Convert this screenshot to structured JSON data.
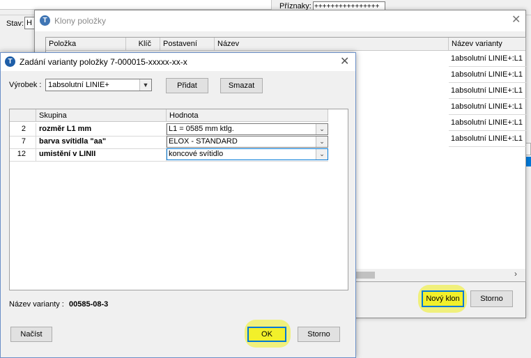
{
  "background": {
    "priznaky_label": "Příznaky:",
    "priznaky_value": "++++++++++++++++",
    "stav_label": "Stav:",
    "stav_value": "H"
  },
  "klony_window": {
    "title": "Klony položky",
    "columns": [
      "Položka",
      "Klíč",
      "Postavení",
      "Název",
      "Název varianty"
    ],
    "rows": [
      "1absolutní LINIE+:L1",
      "1absolutní LINIE+:L1",
      "1absolutní LINIE+:L1",
      "1absolutní LINIE+:L1",
      "1absolutní LINIE+:L1",
      "1absolutní LINIE+:L1"
    ],
    "novy_klon_label": "Nový klon",
    "storno_label": "Storno"
  },
  "dialog": {
    "title": "Zadání varianty položky  7-000015-xxxxx-xx-x",
    "vyrobek_label": "Výrobek :",
    "vyrobek_value": "1absolutní LINIE+",
    "pridat_label": "Přidat",
    "smazat_label": "Smazat",
    "grid": {
      "columns": [
        "",
        "Skupina",
        "Hodnota"
      ],
      "rows": [
        {
          "num": "2",
          "skupina": "rozměr L1 mm",
          "hodnota": "L1 = 0585 mm ktlg."
        },
        {
          "num": "7",
          "skupina": "barva svítidla \"aa\"",
          "hodnota": "ELOX - STANDARD"
        },
        {
          "num": "12",
          "skupina": "umistění v LINII",
          "hodnota": "koncové svítidlo"
        }
      ]
    },
    "nazev_varianty_label": "Název varianty :",
    "nazev_varianty_value": "00585-08-3",
    "nacist_label": "Načíst",
    "ok_label": "OK",
    "storno_label": "Storno"
  },
  "colors": {
    "accent": "#0078d7",
    "highlight": "#f2f02a",
    "app_icon": "#1e5ea8"
  }
}
